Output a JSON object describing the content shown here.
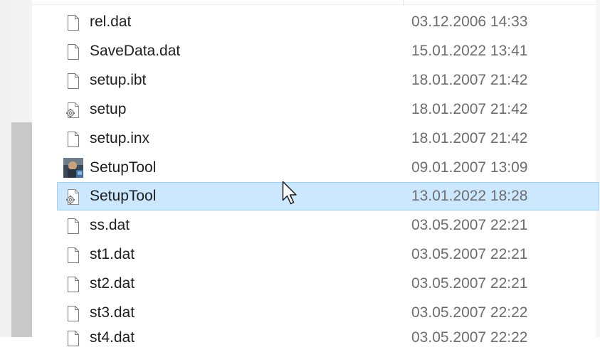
{
  "files": [
    {
      "name": "rel.dat",
      "date": "03.12.2006 14:33",
      "icon": "document-icon"
    },
    {
      "name": "SaveData.dat",
      "date": "15.01.2022 13:41",
      "icon": "document-icon"
    },
    {
      "name": "setup.ibt",
      "date": "18.01.2007 21:42",
      "icon": "document-icon"
    },
    {
      "name": "setup",
      "date": "18.01.2007 21:42",
      "icon": "settings-file-icon"
    },
    {
      "name": "setup.inx",
      "date": "18.01.2007 21:42",
      "icon": "document-icon"
    },
    {
      "name": "SetupTool",
      "date": "09.01.2007 13:09",
      "icon": "application-icon"
    },
    {
      "name": "SetupTool",
      "date": "13.01.2022 18:28",
      "icon": "settings-file-icon",
      "selected": true
    },
    {
      "name": "ss.dat",
      "date": "03.05.2007 22:21",
      "icon": "document-icon"
    },
    {
      "name": "st1.dat",
      "date": "03.05.2007 22:21",
      "icon": "document-icon"
    },
    {
      "name": "st2.dat",
      "date": "03.05.2007 22:21",
      "icon": "document-icon"
    },
    {
      "name": "st3.dat",
      "date": "03.05.2007 22:22",
      "icon": "document-icon"
    },
    {
      "name": "st4.dat",
      "date": "03.05.2007 22:22",
      "icon": "document-icon"
    }
  ],
  "colors": {
    "selection_background": "#cce8ff",
    "selection_border": "#99d1ff",
    "name_text": "#1e1e1e",
    "date_text": "#6d6d6d"
  }
}
